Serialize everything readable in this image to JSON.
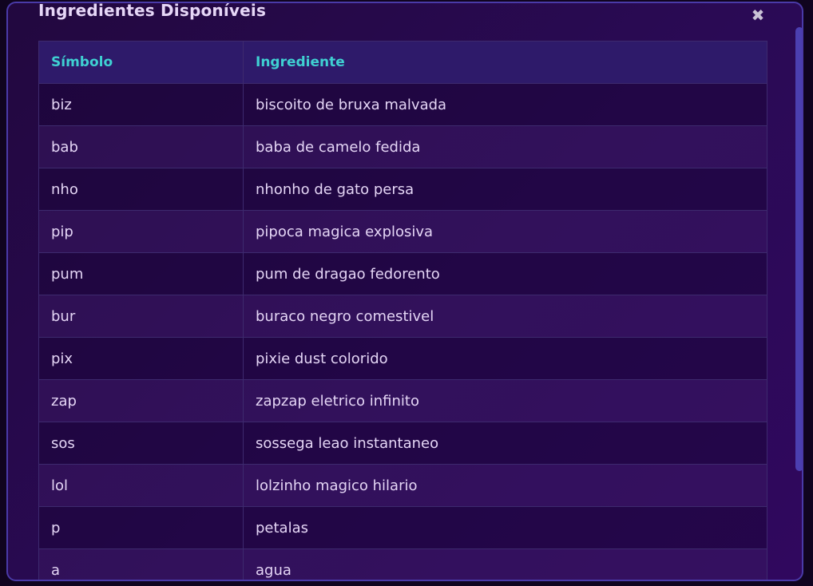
{
  "modal": {
    "title": "Ingredientes Disponíveis",
    "close_label": "✖"
  },
  "table": {
    "headers": [
      "Símbolo",
      "Ingrediente"
    ],
    "rows": [
      [
        "biz",
        "biscoito de bruxa malvada"
      ],
      [
        "bab",
        "baba de camelo fedida"
      ],
      [
        "nho",
        "nhonho de gato persa"
      ],
      [
        "pip",
        "pipoca magica explosiva"
      ],
      [
        "pum",
        "pum de dragao fedorento"
      ],
      [
        "bur",
        "buraco negro comestivel"
      ],
      [
        "pix",
        "pixie dust colorido"
      ],
      [
        "zap",
        "zapzap eletrico infinito"
      ],
      [
        "sos",
        "sossega leao instantaneo"
      ],
      [
        "lol",
        "lolzinho magico hilario"
      ],
      [
        "p",
        "petalas"
      ],
      [
        "a",
        "agua"
      ]
    ]
  },
  "colors": {
    "header_text": "#3fd0d2",
    "body_text": "#e4d5f5",
    "scrollbar": "#4b3fb0"
  }
}
